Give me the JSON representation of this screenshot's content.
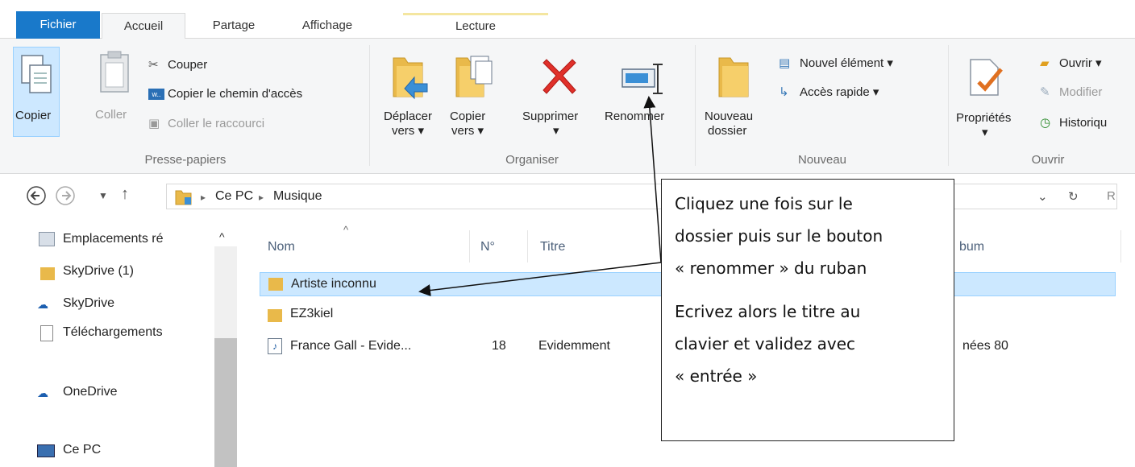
{
  "tabs": {
    "file": "Fichier",
    "home": "Accueil",
    "share": "Partage",
    "view": "Affichage",
    "play": "Lecture"
  },
  "ribbon": {
    "clipboard": {
      "label": "Presse-papiers",
      "copy": "Copier",
      "paste": "Coller",
      "cut": "Couper",
      "copy_path": "Copier le chemin d'accès",
      "paste_shortcut": "Coller le raccourci"
    },
    "organize": {
      "label": "Organiser",
      "move_line1": "Déplacer",
      "move_line2": "vers ▾",
      "copyto_line1": "Copier",
      "copyto_line2": "vers ▾",
      "delete": "Supprimer",
      "delete_arrow": "▾",
      "rename": "Renommer"
    },
    "new": {
      "label": "Nouveau",
      "folder_line1": "Nouveau",
      "folder_line2": "dossier",
      "new_item": "Nouvel élément ▾",
      "quick_access": "Accès rapide ▾"
    },
    "open": {
      "label": "Ouvrir",
      "properties": "Propriétés",
      "properties_arrow": "▾",
      "open": "Ouvrir ▾",
      "edit": "Modifier",
      "history": "Historiqu"
    }
  },
  "address": {
    "crumbs": [
      "Ce PC",
      "Musique"
    ],
    "separator": "▸",
    "dropdown": "⌄",
    "refresh": "↻",
    "search_stub": "R"
  },
  "nav": {
    "items": [
      "Emplacements ré",
      "SkyDrive (1)",
      "SkyDrive",
      "Téléchargements",
      "OneDrive",
      "Ce PC"
    ]
  },
  "filelist": {
    "columns": [
      "Nom",
      "N°",
      "Titre",
      "bum"
    ],
    "sort_arrow": "^",
    "rows": [
      {
        "name": "Artiste inconnu",
        "num": "",
        "title": "",
        "album": ""
      },
      {
        "name": "EZ3kiel",
        "num": "",
        "title": "",
        "album": ""
      },
      {
        "name": "France Gall - Evide...",
        "num": "18",
        "title": "Evidemment",
        "album": "nées 80"
      }
    ]
  },
  "callout": {
    "line1": "Cliquez une fois sur le",
    "line2": "dossier puis sur le bouton",
    "line3": "« renommer » du ruban",
    "line4": "Ecrivez alors le titre au",
    "line5": "clavier et validez avec",
    "line6": "« entrée »"
  },
  "colors": {
    "file_tab": "#1979ca",
    "selection": "#cce8ff",
    "ribbon_bg": "#f5f6f7"
  }
}
